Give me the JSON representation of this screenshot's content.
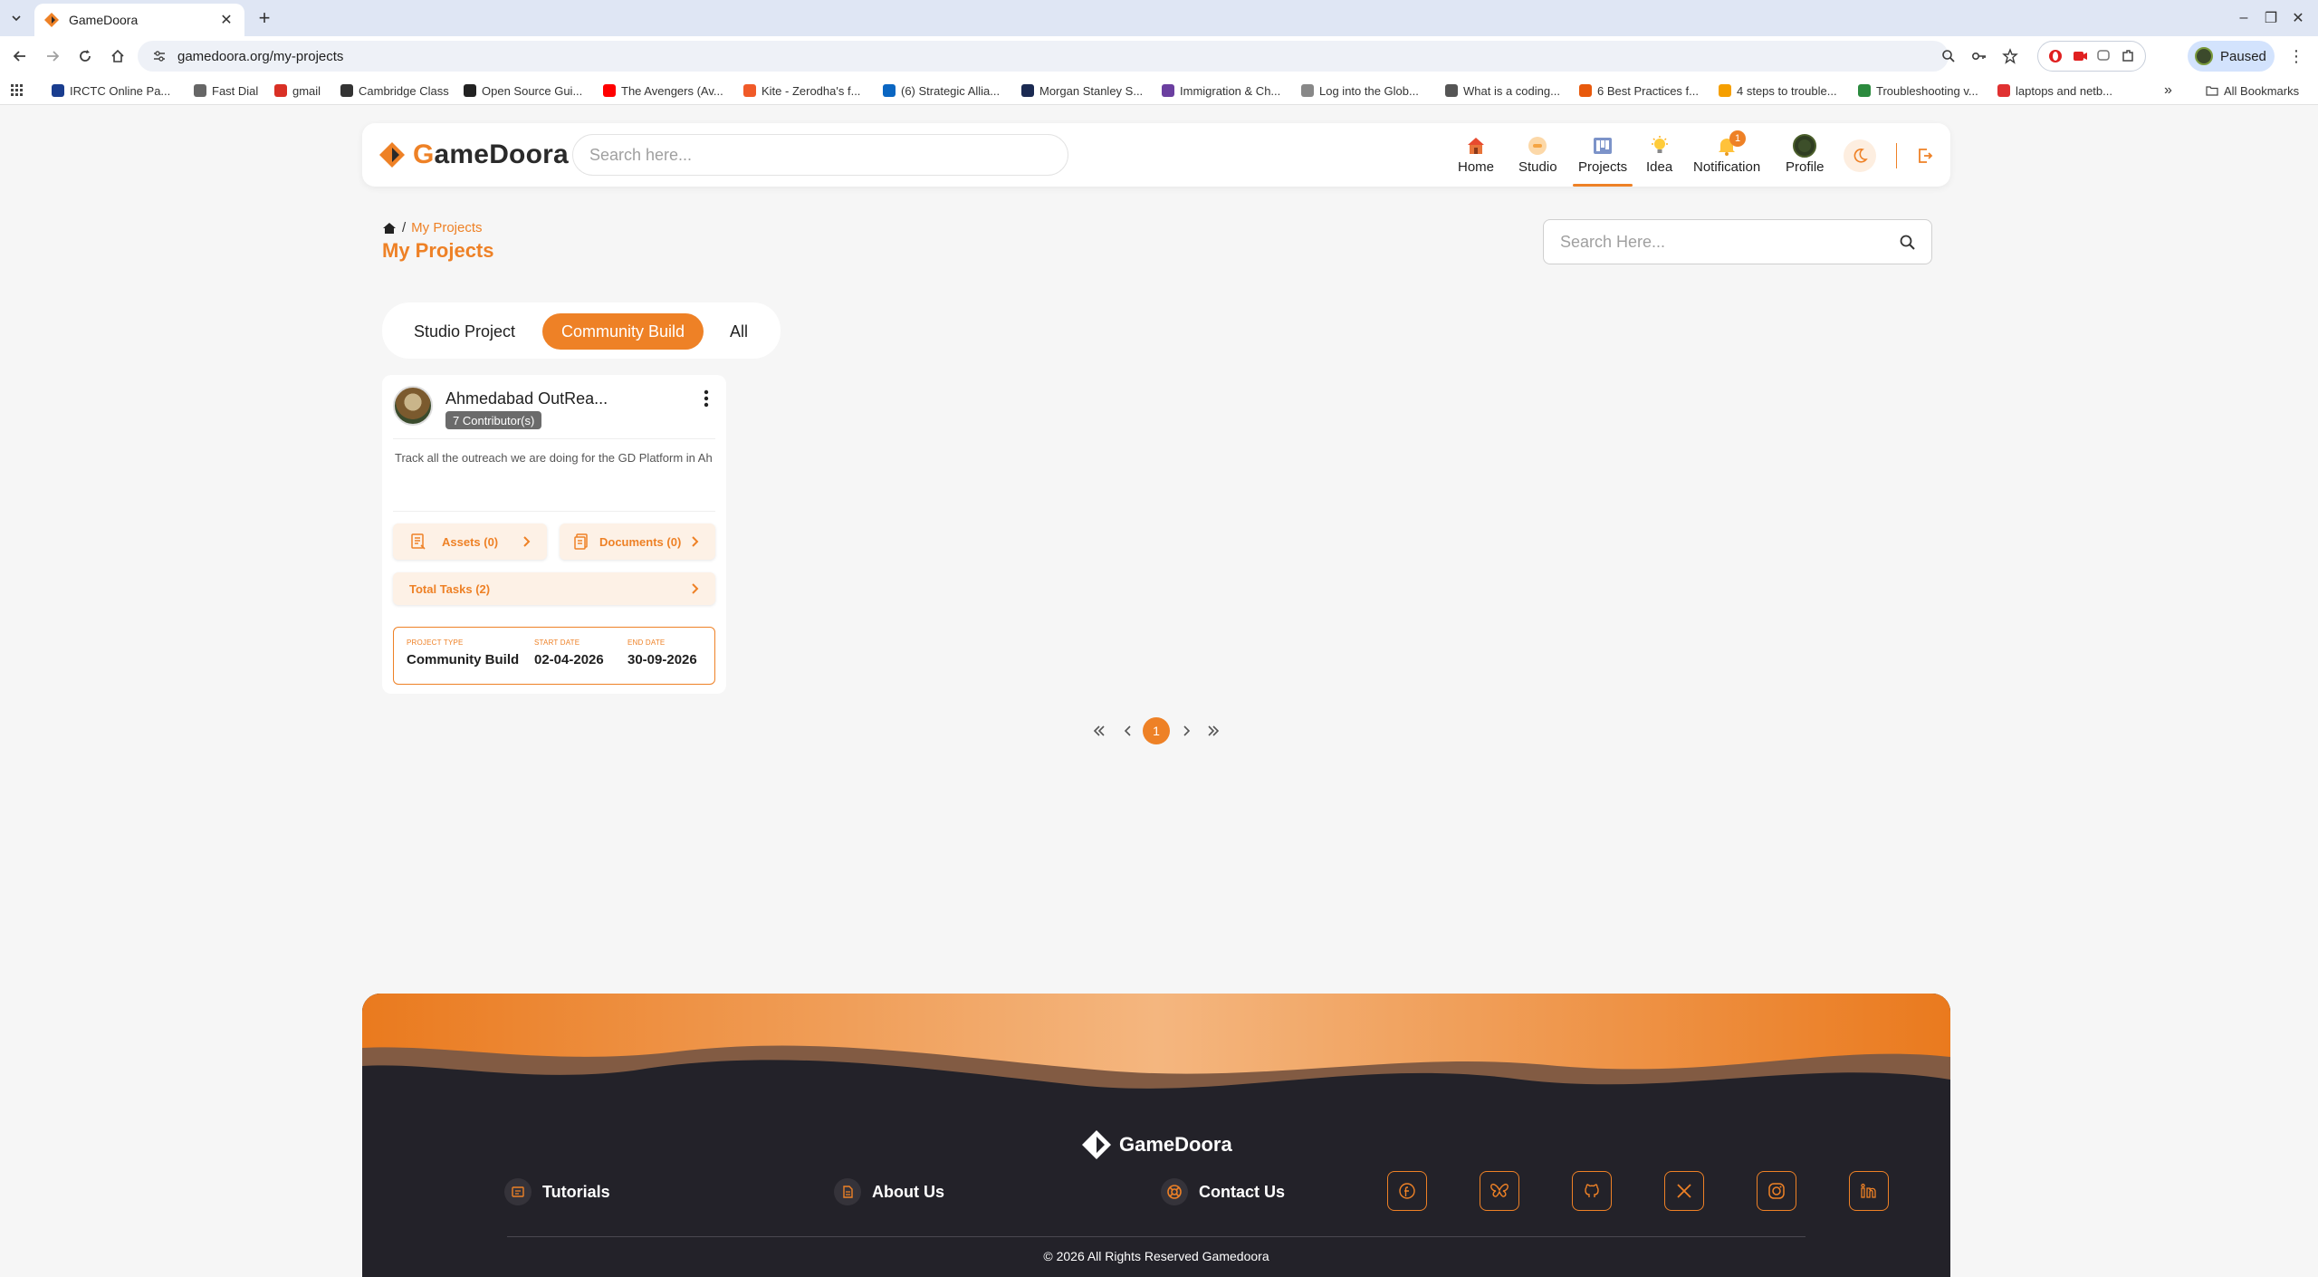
{
  "browser": {
    "tab_title": "GameDoora",
    "url": "gamedoora.org/my-projects",
    "profile_label": "Paused",
    "bookmarks": [
      {
        "label": "IRCTC Online Pa...",
        "color": "#1a3d8f"
      },
      {
        "label": "Fast Dial",
        "color": "#666666"
      },
      {
        "label": "gmail",
        "color": "#d93025"
      },
      {
        "label": "Cambridge Class",
        "color": "#333333"
      },
      {
        "label": "Open Source Gui...",
        "color": "#222222"
      },
      {
        "label": "The Avengers (Av...",
        "color": "#ff0000"
      },
      {
        "label": "Kite - Zerodha's f...",
        "color": "#f05a28"
      },
      {
        "label": "(6) Strategic Allia...",
        "color": "#0a66c2"
      },
      {
        "label": "Morgan Stanley S...",
        "color": "#1b2a52"
      },
      {
        "label": "Immigration & Ch...",
        "color": "#6b3fa0"
      },
      {
        "label": "Log into the Glob...",
        "color": "#888888"
      },
      {
        "label": "What is a coding...",
        "color": "#555555"
      },
      {
        "label": "6 Best Practices f...",
        "color": "#e8590c"
      },
      {
        "label": "4 steps to trouble...",
        "color": "#f59f00"
      },
      {
        "label": "Troubleshooting v...",
        "color": "#2b8a3e"
      },
      {
        "label": "laptops and netb...",
        "color": "#e03131"
      }
    ],
    "all_bookmarks": "All Bookmarks"
  },
  "header": {
    "brand_prefix": "G",
    "brand_rest": "ameDoora",
    "search_placeholder": "Search here...",
    "nav": [
      {
        "label": "Home",
        "icon": "home-icon"
      },
      {
        "label": "Studio",
        "icon": "studio-icon"
      },
      {
        "label": "Projects",
        "icon": "projects-icon",
        "active": true
      },
      {
        "label": "Idea",
        "icon": "lightbulb-icon"
      },
      {
        "label": "Notification",
        "icon": "bell-icon",
        "badge": "1"
      },
      {
        "label": "Profile",
        "icon": "avatar-icon"
      }
    ]
  },
  "page": {
    "breadcrumb": "My Projects",
    "title": "My Projects",
    "search_placeholder": "Search Here...",
    "tabs": [
      "Studio Project",
      "Community Build",
      "All"
    ],
    "active_tab": "Community Build"
  },
  "project": {
    "name": "Ahmedabad OutRea...",
    "contributors": "7 Contributor(s)",
    "description": "Track all the outreach we are doing for the GD Platform in Ah",
    "assets": "Assets (0)",
    "documents": "Documents (0)",
    "tasks": "Total Tasks (2)",
    "type_label": "PROJECT TYPE",
    "type_value": "Community Build",
    "start_label": "START DATE",
    "start_value": "02-04-2026",
    "end_label": "END DATE",
    "end_value": "30-09-2026"
  },
  "pagination": {
    "current": "1"
  },
  "footer": {
    "brand": "GameDoora",
    "links": [
      "Tutorials",
      "About Us",
      "Contact Us"
    ],
    "social": [
      "facebook-icon",
      "butterfly-icon",
      "github-icon",
      "x-icon",
      "instagram-icon",
      "linkedin-icon"
    ],
    "copyright": "© 2026 All Rights Reserved Gamedoora"
  },
  "colors": {
    "accent": "#ee8126",
    "footer_bg": "#232229"
  }
}
